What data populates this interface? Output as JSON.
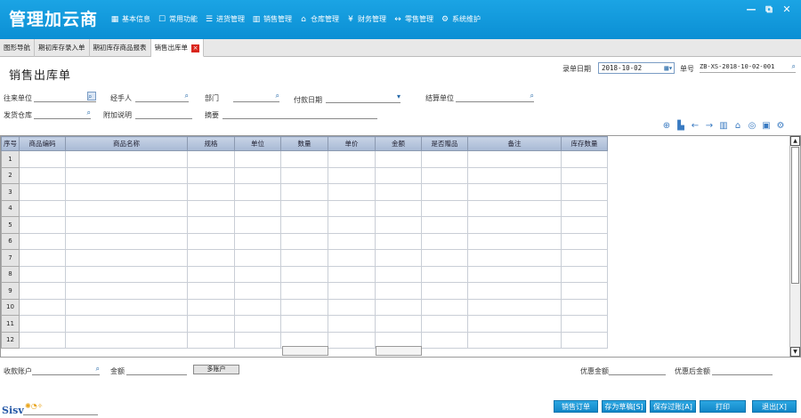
{
  "app": {
    "brand": "管理加云商"
  },
  "menu": [
    {
      "icon": "▦",
      "label": "基本信息",
      "name": "menu-basic-info",
      "icon_name": "grid-icon"
    },
    {
      "icon": "☐",
      "label": "常用功能",
      "name": "menu-common",
      "icon_name": "edit-icon"
    },
    {
      "icon": "☰",
      "label": "进货管理",
      "name": "menu-purchase",
      "icon_name": "list-icon"
    },
    {
      "icon": "▥",
      "label": "销售管理",
      "name": "menu-sales",
      "icon_name": "bar-chart-icon"
    },
    {
      "icon": "⌂",
      "label": "仓库管理",
      "name": "menu-warehouse",
      "icon_name": "home-icon"
    },
    {
      "icon": "¥",
      "label": "财务管理",
      "name": "menu-finance",
      "icon_name": "yen-icon"
    },
    {
      "icon": "↔",
      "label": "零售管理",
      "name": "menu-retail",
      "icon_name": "exchange-icon"
    },
    {
      "icon": "⚙",
      "label": "系统维护",
      "name": "menu-system",
      "icon_name": "gear-icon"
    }
  ],
  "window": {
    "minimize": "—",
    "restore": "⧉",
    "close": "✕"
  },
  "tabs": [
    {
      "label": "图形导航",
      "active": false
    },
    {
      "label": "期初库存录入单",
      "active": false
    },
    {
      "label": "期初库存商品报表",
      "active": false
    },
    {
      "label": "销售出库单",
      "active": true
    }
  ],
  "tab_close": "×",
  "page_title": "销售出库单",
  "header": {
    "record_date_label": "录单日期",
    "record_date_value": "2018-10-02",
    "doc_no_label": "单号",
    "doc_no_value": "ZB-XS-2018-10-02-001"
  },
  "form": {
    "partner": "往来单位",
    "handler": "经手人",
    "dept": "部门",
    "pay_date": "付款日期",
    "settle": "结算单位",
    "warehouse": "发货仓库",
    "extra": "附加说明",
    "summary": "摘要"
  },
  "grid": {
    "columns": [
      "序号",
      "商品编码",
      "商品名称",
      "规格",
      "单位",
      "数量",
      "单价",
      "金额",
      "是否赠品",
      "备注",
      "库存数量"
    ],
    "rows": [
      "1",
      "2",
      "3",
      "4",
      "5",
      "6",
      "7",
      "8",
      "9",
      "10",
      "11",
      "12"
    ]
  },
  "footer": {
    "account_label": "收款账户",
    "amount_label": "金额",
    "multi_account": "多账户",
    "discount_label": "优惠金额",
    "after_discount_label": "优惠后金额"
  },
  "buttons": {
    "sales_order": "销售订单",
    "save_draft": "存为草稿[S]",
    "save_post": "保存过账[A]",
    "print": "打印",
    "exit": "退出[X]"
  },
  "logo_text": "Sisv"
}
